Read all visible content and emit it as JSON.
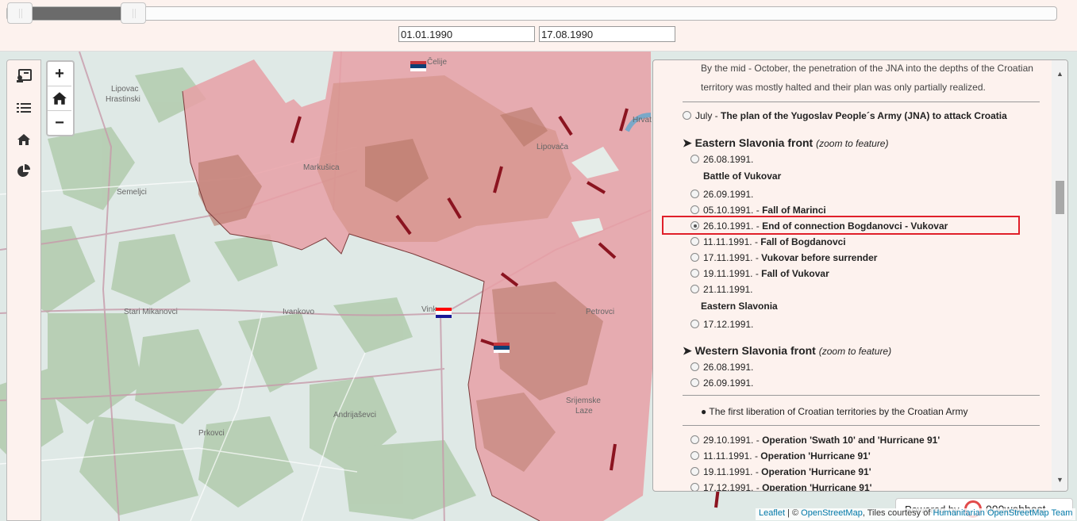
{
  "timeline": {
    "start_date": "01.01.1990",
    "end_date": "17.08.1990"
  },
  "map": {
    "places": [
      "Čelije",
      "Lipovac",
      "Hrastinski",
      "Markušica",
      "Semeljci",
      "Lipovača",
      "Hrvat",
      "Stari Mikanovci",
      "Ivankovo",
      "Vink",
      "Petrovci",
      "Srijemske",
      "Laze",
      "Andrijaševci",
      "Prkovci"
    ],
    "colors": {
      "occupied": "#e8a0a6",
      "occupied_dark": "#b57766",
      "forest": "#b4cdb0",
      "base": "#dfe9e6",
      "arrow": "#8b1420",
      "border": "#b4708a"
    }
  },
  "sidebar": {
    "icons": [
      "contact-card-icon",
      "list-icon",
      "home-icon",
      "pie-chart-icon"
    ]
  },
  "zoom": {
    "in": "+",
    "home": "⌂",
    "out": "−"
  },
  "panel": {
    "intro_line1": "By the mid - October, the penetration of the JNA into the depths of the Croatian",
    "intro_line2": "territory was mostly halted and their plan was only partially realized.",
    "july_date": "July - ",
    "july_text": "The plan of the Yugoslav People´s Army (JNA) to attack Croatia",
    "east_header": "➤ Eastern Slavonia front",
    "east_zoom": "(zoom to feature)",
    "east_items": [
      {
        "date": "26.08.1991.",
        "text": ""
      },
      {
        "date": "",
        "text": "Battle of Vukovar"
      },
      {
        "date": "26.09.1991.",
        "text": ""
      },
      {
        "date": "05.10.1991. - ",
        "text": "Fall of Marinci"
      },
      {
        "date": "26.10.1991. - ",
        "text": "End of connection Bogdanovci - Vukovar"
      },
      {
        "date": "11.11.1991. - ",
        "text": "Fall of Bogdanovci"
      },
      {
        "date": "17.11.1991. - ",
        "text": "Vukovar before surrender"
      },
      {
        "date": "19.11.1991. - ",
        "text": "Fall of Vukovar"
      },
      {
        "date": "21.11.1991.",
        "text": ""
      },
      {
        "date": "",
        "text": "Eastern Slavonia"
      },
      {
        "date": "17.12.1991.",
        "text": ""
      }
    ],
    "west_header": "➤ Western Slavonia front",
    "west_zoom": "(zoom to feature)",
    "west_items": [
      {
        "date": "26.08.1991.",
        "text": ""
      },
      {
        "date": "26.09.1991.",
        "text": ""
      }
    ],
    "liberation_note": "● The first liberation of Croatian territories by the Croatian Army",
    "liberation_items": [
      {
        "date": "29.10.1991. - ",
        "text": "Operation 'Swath 10' and 'Hurricane 91'"
      },
      {
        "date": "11.11.1991. - ",
        "text": "Operation 'Hurricane 91'"
      },
      {
        "date": "19.11.1991. - ",
        "text": "Operation 'Hurricane 91'"
      },
      {
        "date": "17.12.1991. - ",
        "text": "Operation 'Hurricane 91'"
      }
    ],
    "selected_index": 4
  },
  "attribution": {
    "leaflet": "Leaflet",
    "sep": " | © ",
    "osm": "OpenStreetMap",
    "tiles": ", Tiles courtesy of ",
    "hot": "Humanitarian OpenStreetMap Team"
  },
  "powered": {
    "label": "Powered by",
    "brand": "000webhost"
  }
}
